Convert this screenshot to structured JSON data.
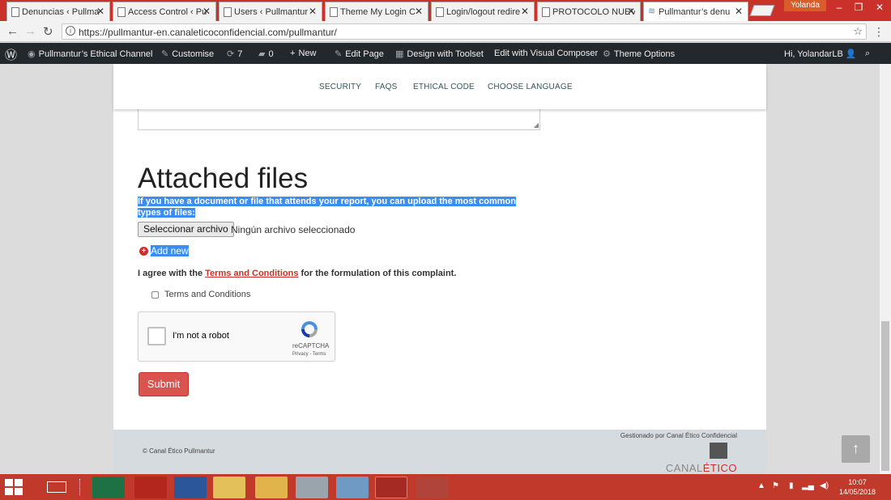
{
  "browser": {
    "tabs": [
      {
        "title": "Denuncias ‹ Pullma",
        "active": false
      },
      {
        "title": "Access Control ‹ Pu",
        "active": false
      },
      {
        "title": "Users ‹ Pullmantur",
        "active": false
      },
      {
        "title": "Theme My Login C",
        "active": false
      },
      {
        "title": "Login/logout redire",
        "active": false
      },
      {
        "title": "PROTOCOLO NUEV",
        "active": false
      },
      {
        "title": "Pullmantur’s denu",
        "active": true
      }
    ],
    "user_label": "Yolanda",
    "url": "https://pullmantur-en.canaleticoconfidencial.com/pullmantur/"
  },
  "adminbar": {
    "site_name": "Pullmantur’s Ethical Channel",
    "customise": "Customise",
    "updates_count": "7",
    "comments_count": "0",
    "new": "New",
    "edit_page": "Edit Page",
    "design_toolset": "Design with Toolset",
    "visual_composer": "Edit with Visual Composer",
    "theme_options": "Theme Options",
    "greeting": "Hi, YolandarLB"
  },
  "sitenav": {
    "items": [
      "SECURITY",
      "FAQS",
      "ETHICAL CODE",
      "CHOOSE LANGUAGE"
    ]
  },
  "form": {
    "heading": "Attached files",
    "help_line1": "If you have a document or file that attends your report, you can upload the most common",
    "help_line2": "types of files:",
    "file_button": "Seleccionar archivo",
    "no_file": "Ningún archivo seleccionado",
    "add_new": "Add new",
    "agree_prefix": "I agree with the",
    "agree_link": "Terms and Conditions",
    "agree_suffix": "for the formulation of this complaint.",
    "tc_checkbox_label": "Terms and Conditions",
    "recaptcha_label": "I'm not a robot",
    "recaptcha_brand": "reCAPTCHA",
    "recaptcha_links": "Privacy - Terms",
    "submit": "Submit"
  },
  "footer": {
    "copyright": "© Canal Ético Pullmantur",
    "managed_by": "Gestionado por Canal Ético Confidencial",
    "logo_text_a": "CANAL",
    "logo_text_b": "ÉTICO"
  },
  "taskbar": {
    "time": "10:07",
    "date": "14/05/2018"
  },
  "colors": {
    "accent_red": "#d9534f",
    "taskbar": "#c0392b",
    "adminbar": "#23282d",
    "selection": "#3b8df0"
  }
}
